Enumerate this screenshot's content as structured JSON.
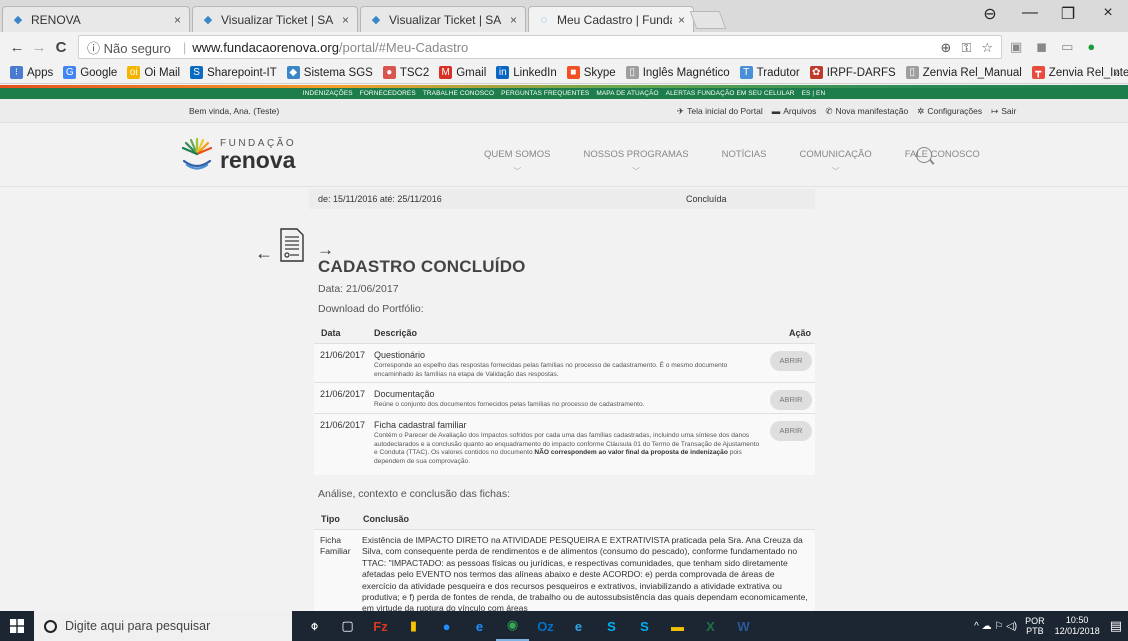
{
  "browser": {
    "tabs": [
      {
        "label": "RENOVA",
        "close": "×",
        "active": false
      },
      {
        "label": "Visualizar Ticket | SA Info",
        "close": "×",
        "active": false
      },
      {
        "label": "Visualizar Ticket | SA Info",
        "close": "×",
        "active": false
      },
      {
        "label": "Meu Cadastro | Fundação",
        "close": "×",
        "active": true
      }
    ],
    "window_controls": {
      "profile": "⊖",
      "minimize": "—",
      "maximize": "❐",
      "close": "×"
    },
    "nav": {
      "back": "←",
      "forward": "→",
      "reload": "C"
    },
    "omnibox": {
      "security": "ⓘ Não seguro",
      "separator": "|",
      "host": "www.fundacaorenova.org",
      "path": "/portal/#Meu-Cadastro"
    },
    "bookmarks": [
      {
        "label": "Apps",
        "icon_color": "#4a7bd0",
        "glyph": "⁝"
      },
      {
        "label": "Google",
        "icon_color": "#4285f4",
        "glyph": "G"
      },
      {
        "label": "Oi Mail",
        "icon_color": "#f4b400",
        "glyph": "oi"
      },
      {
        "label": "Sharepoint-IT",
        "icon_color": "#0a6abf",
        "glyph": "S"
      },
      {
        "label": "Sistema SGS",
        "icon_color": "#3a86c8",
        "glyph": "◆"
      },
      {
        "label": "TSC2",
        "icon_color": "#d9534f",
        "glyph": "●"
      },
      {
        "label": "Gmail",
        "icon_color": "#d93025",
        "glyph": "M"
      },
      {
        "label": "LinkedIn",
        "icon_color": "#0a66c2",
        "glyph": "in"
      },
      {
        "label": "Skype",
        "icon_color": "#f25022",
        "glyph": "■"
      },
      {
        "label": "Inglês Magnético",
        "icon_color": "#9e9e9e",
        "glyph": "▯"
      },
      {
        "label": "Tradutor",
        "icon_color": "#4a90d9",
        "glyph": "T"
      },
      {
        "label": "IRPF-DARFS",
        "icon_color": "#c0392b",
        "glyph": "✿"
      },
      {
        "label": "Zenvia Rel_Manual",
        "icon_color": "#9e9e9e",
        "glyph": "▯"
      },
      {
        "label": "Zenvia Rel_Integraçã",
        "icon_color": "#e84c3d",
        "glyph": "┳"
      }
    ],
    "bookmarks_more": "»"
  },
  "site": {
    "topnav_links": [
      "INDENIZAÇÕES",
      "FORNECEDORES",
      "TRABALHE CONOSCO",
      "PERGUNTAS FREQUENTES",
      "MAPA DE ATUAÇÃO",
      "ALERTAS FUNDAÇÃO EM SEU CELULAR",
      "ES | EN"
    ],
    "welcome": "Bem vinda, Ana. (Teste)",
    "user_links": [
      {
        "icon": "✈",
        "label": "Tela inicial do Portal"
      },
      {
        "icon": "▬",
        "label": "Arquivos"
      },
      {
        "icon": "✆",
        "label": "Nova manifestação"
      },
      {
        "icon": "✲",
        "label": "Configurações"
      },
      {
        "icon": "↦",
        "label": "Sair"
      }
    ],
    "logo_top": "FUNDAÇÃO",
    "logo_main": "renova",
    "main_nav": [
      {
        "label": "QUEM SOMOS",
        "has_dropdown": true
      },
      {
        "label": "NOSSOS PROGRAMAS",
        "has_dropdown": true
      },
      {
        "label": "NOTÍCIAS",
        "has_dropdown": false
      },
      {
        "label": "COMUNICAÇÃO",
        "has_dropdown": true
      },
      {
        "label": "FALE CONOSCO",
        "has_dropdown": false
      }
    ],
    "chevron": "﹀"
  },
  "content": {
    "previous_row": {
      "period": "de: 15/11/2016 até: 25/11/2016",
      "status": "Concluída"
    },
    "arrow_left": "←",
    "arrow_right": "→",
    "title": "CADASTRO CONCLUÍDO",
    "date": "Data: 21/06/2017",
    "download_label": "Download do Portfólio:",
    "portfolio_headers": {
      "date": "Data",
      "desc": "Descrição",
      "action": "Ação"
    },
    "portfolio": [
      {
        "date": "21/06/2017",
        "title": "Questionário",
        "desc": "Corresponde ao espelho das respostas fornecidas pelas famílias no processo de cadastramento. É o mesmo documento encaminhado às famílias na etapa de Validação das respostas.",
        "action": "ABRIR"
      },
      {
        "date": "21/06/2017",
        "title": "Documentação",
        "desc": "Reúne o conjunto dos documentos fornecidos pelas famílias no processo de cadastramento.",
        "action": "ABRIR"
      },
      {
        "date": "21/06/2017",
        "title": "Ficha cadastral familiar",
        "desc": "Contém o Parecer de Avaliação dos Impactos sofridos por cada uma das famílias cadastradas, incluindo uma síntese dos danos autodeclarados e a conclusão quanto ao enquadramento do impacto conforme Cláusula 01 do Termo de Transação de Ajustamento e Conduta (TTAC). Os valores contidos no documento ",
        "desc_bold": "NÃO correspondem ao valor final da proposta de indenização",
        "desc_tail": " pois dependem de sua comprovação.",
        "action": "ABRIR"
      }
    ],
    "analysis_title": "Análise, contexto e conclusão das fichas:",
    "analysis_headers": {
      "type": "Tipo",
      "conclusion": "Conclusão"
    },
    "analysis_row": {
      "type": "Ficha Familiar",
      "text": "Existência de IMPACTO DIRETO na ATIVIDADE PESQUEIRA E EXTRATIVISTA praticada pela Sra. Ana Creuza da Silva, com consequente perda de rendimentos e de alimentos (consumo do pescado), conforme fundamentado no TTAC: \"IMPACTADO: as pessoas físicas ou jurídicas, e respectivas comunidades, que tenham sido diretamente afetadas pelo EVENTO nos termos das alíneas abaixo e deste ACORDO: e) perda comprovada de áreas de exercício da atividade pesqueira e dos recursos pesqueiros e extrativos, inviabilizando a atividade extrativa ou produtiva; e f) perda de fontes de renda, de trabalho ou de autossubsistência das quais dependam economicamente, em virtude da ruptura do vínculo com áreas"
    }
  },
  "taskbar": {
    "search_placeholder": "Digite aqui para pesquisar",
    "apps": [
      {
        "glyph": "⌽",
        "color": "#ffffff"
      },
      {
        "glyph": "▢",
        "color": "#ffffff"
      },
      {
        "glyph": "Fz",
        "color": "#d9381e"
      },
      {
        "glyph": "▮",
        "color": "#f7c200"
      },
      {
        "glyph": "●",
        "color": "#1e90ff"
      },
      {
        "glyph": "e",
        "color": "#1e90ff"
      },
      {
        "glyph": "◉",
        "color": "#34a853"
      },
      {
        "glyph": "Oz",
        "color": "#0072c6"
      },
      {
        "glyph": "e",
        "color": "#2fa3e6"
      },
      {
        "glyph": "S",
        "color": "#00aff0"
      },
      {
        "glyph": "S",
        "color": "#00aff0"
      },
      {
        "glyph": "▬",
        "color": "#f2c200"
      },
      {
        "glyph": "X",
        "color": "#1f7244"
      },
      {
        "glyph": "W",
        "color": "#2b579a"
      }
    ],
    "tray_icons": "^ ☁ ⚐ ◁)",
    "lang_top": "POR",
    "lang_bottom": "PTB",
    "time": "10:50",
    "date": "12/01/2018",
    "notification": "▤"
  }
}
